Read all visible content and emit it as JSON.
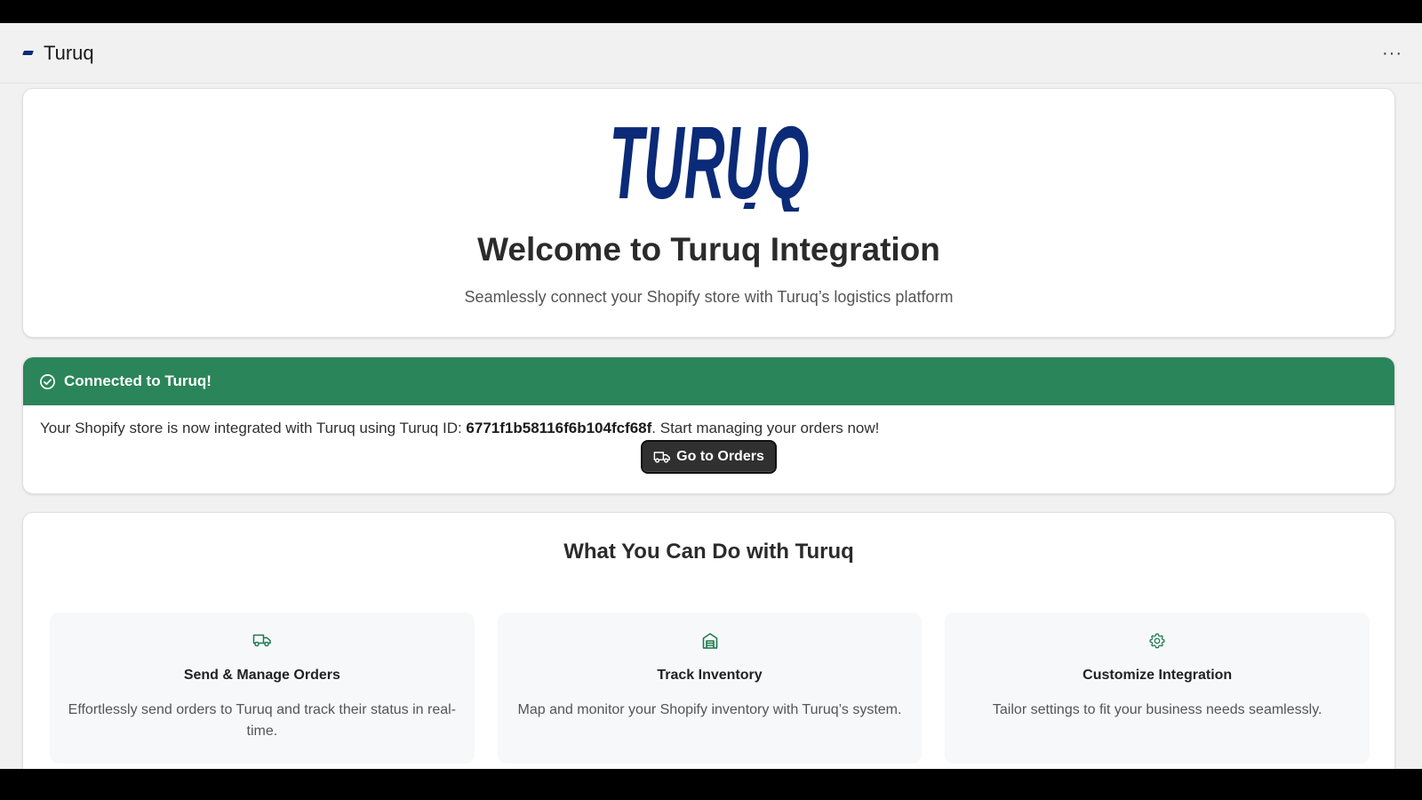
{
  "app": {
    "title": "Turuq",
    "more_label": "···"
  },
  "hero": {
    "logo_text": "TURUQ",
    "title": "Welcome to Turuq Integration",
    "subtitle": "Seamlessly connect your Shopify store with Turuq’s logistics platform"
  },
  "status": {
    "title": "Connected to Turuq!",
    "message_prefix": "Your Shopify store is now integrated with Turuq using Turuq ID: ",
    "turuq_id": "6771f1b58116f6b104fcf68f",
    "message_suffix": ". Start managing your orders now!",
    "button_label": "Go to Orders"
  },
  "features": {
    "title": "What You Can Do with Turuq",
    "items": [
      {
        "icon": "truck-icon",
        "title": "Send & Manage Orders",
        "desc": "Effortlessly send orders to Turuq and track their status in real-time."
      },
      {
        "icon": "warehouse-icon",
        "title": "Track Inventory",
        "desc": "Map and monitor your Shopify inventory with Turuq’s system."
      },
      {
        "icon": "gear-icon",
        "title": "Customize Integration",
        "desc": "Tailor settings to fit your business needs seamlessly."
      }
    ]
  },
  "colors": {
    "brand_navy": "#0b2a78",
    "success_green": "#2b855a",
    "icon_green": "#1f7a4d",
    "button_dark": "#303030"
  }
}
